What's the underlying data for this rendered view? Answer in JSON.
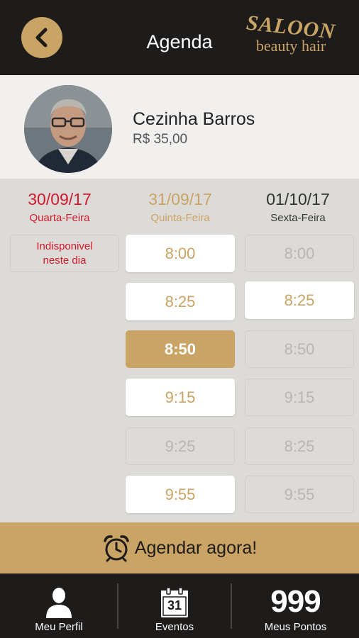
{
  "header": {
    "title": "Agenda",
    "logo_line1": "SALOON",
    "logo_line2": "beauty hair",
    "brand_color": "#c9a464",
    "back_icon": "chevron-left-icon"
  },
  "professional": {
    "name": "Cezinha Barros",
    "price": "R$ 35,00"
  },
  "days": [
    {
      "date": "30/09/17",
      "weekday": "Quarta-Feira",
      "unavailable_text": "Indisponivel neste dia"
    },
    {
      "date": "31/09/17",
      "weekday": "Quinta-Feira"
    },
    {
      "date": "01/10/17",
      "weekday": "Sexta-Feira"
    }
  ],
  "slots": {
    "day2": [
      {
        "time": "8:00",
        "state": "available"
      },
      {
        "time": "8:25",
        "state": "available"
      },
      {
        "time": "8:50",
        "state": "selected"
      },
      {
        "time": "9:15",
        "state": "available"
      },
      {
        "time": "9:25",
        "state": "disabled"
      },
      {
        "time": "9:55",
        "state": "available"
      }
    ],
    "day3": [
      {
        "time": "8:00",
        "state": "disabled"
      },
      {
        "time": "8:25",
        "state": "available"
      },
      {
        "time": "8:50",
        "state": "disabled"
      },
      {
        "time": "9:15",
        "state": "disabled"
      },
      {
        "time": "8:25",
        "state": "disabled"
      },
      {
        "time": "9:55",
        "state": "disabled"
      }
    ]
  },
  "book_button": {
    "label": "Agendar agora!",
    "icon": "alarm-clock-icon"
  },
  "nav": {
    "profile": {
      "label": "Meu Perfil",
      "icon": "person-icon"
    },
    "events": {
      "label": "Eventos",
      "icon": "calendar-icon",
      "calendar_day": "31"
    },
    "points": {
      "label": "Meus Pontos",
      "value": "999"
    }
  }
}
